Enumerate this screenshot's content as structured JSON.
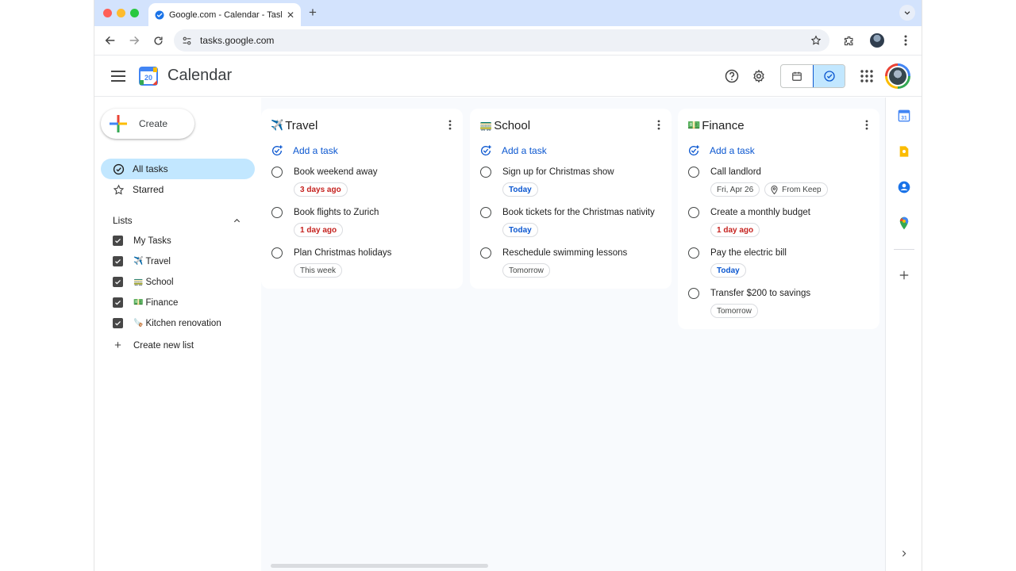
{
  "browser": {
    "tab_title": "Google.com - Calendar - Tasks",
    "url": "tasks.google.com"
  },
  "app": {
    "title": "Calendar"
  },
  "sidebar": {
    "create_label": "Create",
    "nav": [
      {
        "label": "All tasks",
        "icon": "task-check-icon",
        "active": true
      },
      {
        "label": "Starred",
        "icon": "star-icon",
        "active": false
      }
    ],
    "lists_heading": "Lists",
    "lists": [
      {
        "emoji": "",
        "label": "My Tasks",
        "checked": true
      },
      {
        "emoji": "✈️",
        "label": "Travel",
        "checked": true
      },
      {
        "emoji": "🚃",
        "label": "School",
        "checked": true
      },
      {
        "emoji": "💵",
        "label": "Finance",
        "checked": true
      },
      {
        "emoji": "🪚",
        "label": "Kitchen renovation",
        "checked": true
      }
    ],
    "create_list_label": "Create new list"
  },
  "cards": [
    {
      "emoji": "✈️",
      "title": "Travel",
      "add_label": "Add a task",
      "tasks": [
        {
          "title": "Book weekend away",
          "chips": [
            {
              "text": "3 days ago",
              "tone": "red"
            }
          ]
        },
        {
          "title": "Book flights to Zurich",
          "chips": [
            {
              "text": "1 day ago",
              "tone": "red"
            }
          ]
        },
        {
          "title": "Plan Christmas holidays",
          "chips": [
            {
              "text": "This week",
              "tone": "neutral"
            }
          ]
        }
      ]
    },
    {
      "emoji": "🚃",
      "title": "School",
      "add_label": "Add a task",
      "tasks": [
        {
          "title": "Sign up for Christmas show",
          "chips": [
            {
              "text": "Today",
              "tone": "blue"
            }
          ]
        },
        {
          "title": "Book tickets for the Christmas nativity",
          "chips": [
            {
              "text": "Today",
              "tone": "blue"
            }
          ]
        },
        {
          "title": "Reschedule swimming lessons",
          "chips": [
            {
              "text": "Tomorrow",
              "tone": "neutral"
            }
          ]
        }
      ]
    },
    {
      "emoji": "💵",
      "title": "Finance",
      "add_label": "Add a task",
      "tasks": [
        {
          "title": "Call landlord",
          "chips": [
            {
              "text": "Fri, Apr 26",
              "tone": "neutral"
            },
            {
              "text": "From Keep",
              "tone": "neutral",
              "icon": "keep-pin-icon"
            }
          ]
        },
        {
          "title": "Create a monthly budget",
          "chips": [
            {
              "text": "1 day ago",
              "tone": "red"
            }
          ]
        },
        {
          "title": "Pay the electric bill",
          "chips": [
            {
              "text": "Today",
              "tone": "blue"
            }
          ]
        },
        {
          "title": "Transfer $200 to savings",
          "chips": [
            {
              "text": "Tomorrow",
              "tone": "neutral"
            }
          ]
        }
      ]
    }
  ],
  "colors": {
    "accent_blue": "#0b57d0",
    "active_bg": "#c2e7ff",
    "overdue_red": "#c5221f",
    "tabstrip": "#d3e3fd"
  },
  "rail": {
    "icons": [
      "calendar-app-icon",
      "keep-app-icon",
      "contacts-app-icon",
      "maps-app-icon",
      "add-icon",
      "chevron-right-icon"
    ],
    "calendar_badge": "31"
  }
}
